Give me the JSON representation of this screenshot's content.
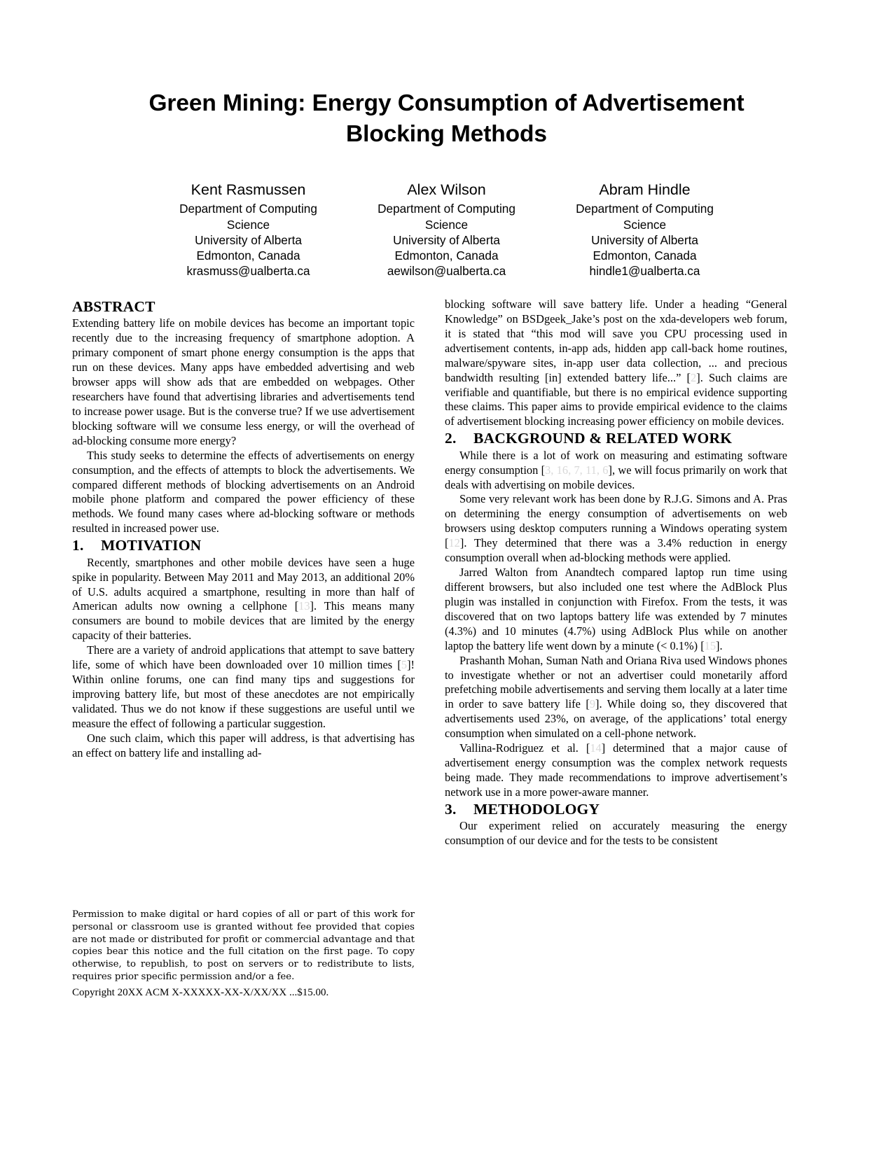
{
  "paper": {
    "title": "Green Mining: Energy Consumption of Advertisement Blocking Methods",
    "authors": [
      {
        "name": "Kent Rasmussen",
        "dept": "Department of Computing",
        "dept2": "Science",
        "institution": "University of Alberta",
        "city": "Edmonton, Canada",
        "email": "krasmuss@ualberta.ca"
      },
      {
        "name": "Alex Wilson",
        "dept": "Department of Computing",
        "dept2": "Science",
        "institution": "University of Alberta",
        "city": "Edmonton, Canada",
        "email": "aewilson@ualberta.ca"
      },
      {
        "name": "Abram Hindle",
        "dept": "Department of Computing",
        "dept2": "Science",
        "institution": "University of Alberta",
        "city": "Edmonton, Canada",
        "email": "hindle1@ualberta.ca"
      }
    ]
  },
  "abstract": {
    "heading": "ABSTRACT",
    "p1": "Extending battery life on mobile devices has become an important topic recently due to the increasing frequency of smartphone adoption. A primary component of smart phone energy consumption is the apps that run on these devices. Many apps have embedded advertising and web browser apps will show ads that are embedded on webpages. Other researchers have found that advertising libraries and advertisements tend to increase power usage. But is the converse true? If we use advertisement blocking software will we consume less energy, or will the overhead of ad-blocking consume more energy?",
    "p2": "This study seeks to determine the effects of advertisements on energy consumption, and the effects of attempts to block the advertisements. We compared different methods of blocking advertisements on an Android mobile phone platform and compared the power efficiency of these methods. We found many cases where ad-blocking software or methods resulted in increased power use."
  },
  "motivation": {
    "number": "1.",
    "heading": "MOTIVATION",
    "p1_a": "Recently, smartphones and other mobile devices have seen a huge spike in popularity. Between May 2011 and May 2013, an additional 20% of U.S. adults acquired a smartphone, resulting in more than half of American adults now owning a cellphone [",
    "p1_cite": "13",
    "p1_b": "]. This means many consumers are bound to mobile devices that are limited by the energy capacity of their batteries.",
    "p2_a": "There are a variety of android applications that attempt to save battery life, some of which have been downloaded over 10 million times [",
    "p2_cite": "5",
    "p2_b": "]! Within online forums, one can find many tips and suggestions for improving battery life, but most of these anecdotes are not empirically validated. Thus we do not know if these suggestions are useful until we measure the effect of following a particular suggestion.",
    "p3": "One such claim, which this paper will address, is that advertising has an effect on battery life and installing ad-"
  },
  "copyright": {
    "line1": "Permission to make digital or hard copies of all or part of this work for personal or classroom use is granted without fee provided that copies are not made or distributed for profit or commercial advantage and that copies bear this notice and the full citation on the first page. To copy otherwise, to republish, to post on servers or to redistribute to lists, requires prior specific permission and/or a fee.",
    "line2": "Copyright 20XX ACM X-XXXXX-XX-X/XX/XX ...$15.00."
  },
  "column2": {
    "continuation_a": "blocking software will save battery life. Under a heading “General Knowledge” on BSDgeek_Jake’s post on the xda-developers web forum, it is stated that “this mod will save you CPU processing used in advertisement contents, in-app ads, hidden app call-back home routines, malware/spyware sites, in-app user data collection, ... and precious bandwidth resulting [in] extended battery life...” [",
    "continuation_cite": "2",
    "continuation_b": "]. Such claims are verifiable and quantifiable, but there is no empirical evidence supporting these claims. This paper aims to provide empirical evidence to the claims of advertisement blocking increasing power efficiency on mobile devices."
  },
  "background": {
    "number": "2.",
    "heading": "BACKGROUND & RELATED WORK",
    "p1_a": "While there is a lot of work on measuring and estimating software energy consumption [",
    "p1_cite": "3, 16, 7, 11, 6",
    "p1_b": "], we will focus primarily on work that deals with advertising on mobile devices.",
    "p2_a": "Some very relevant work has been done by R.J.G. Simons and A. Pras on determining the energy consumption of advertisements on web browsers using desktop computers running a Windows operating system [",
    "p2_cite": "12",
    "p2_b": "]. They determined that there was a 3.4% reduction in energy consumption overall when ad-blocking methods were applied.",
    "p3_a": "Jarred Walton from Anandtech compared laptop run time using different browsers, but also included one test where the AdBlock Plus plugin was installed in conjunction with Firefox. From the tests, it was discovered that on two laptops battery life was extended by 7 minutes (4.3%) and 10 minutes (4.7%) using AdBlock Plus while on another laptop the battery life went down by a minute (< 0.1%) [",
    "p3_cite": "15",
    "p3_b": "].",
    "p4_a": "Prashanth Mohan, Suman Nath and Oriana Riva used Windows phones to investigate whether or not an advertiser could monetarily afford prefetching mobile advertisements and serving them locally at a later time in order to save battery life [",
    "p4_cite": "9",
    "p4_b": "]. While doing so, they discovered that advertisements used 23%, on average, of the applications’ total energy consumption when simulated on a cell-phone network.",
    "p5_a": "Vallina-Rodriguez et al. [",
    "p5_cite": "14",
    "p5_b": "] determined that a major cause of advertisement energy consumption was the complex network requests being made. They made recommendations to improve advertisement’s network use in a more power-aware manner."
  },
  "methodology": {
    "number": "3.",
    "heading": "METHODOLOGY",
    "p1": "Our experiment relied on accurately measuring the energy consumption of our device and for the tests to be consistent"
  }
}
